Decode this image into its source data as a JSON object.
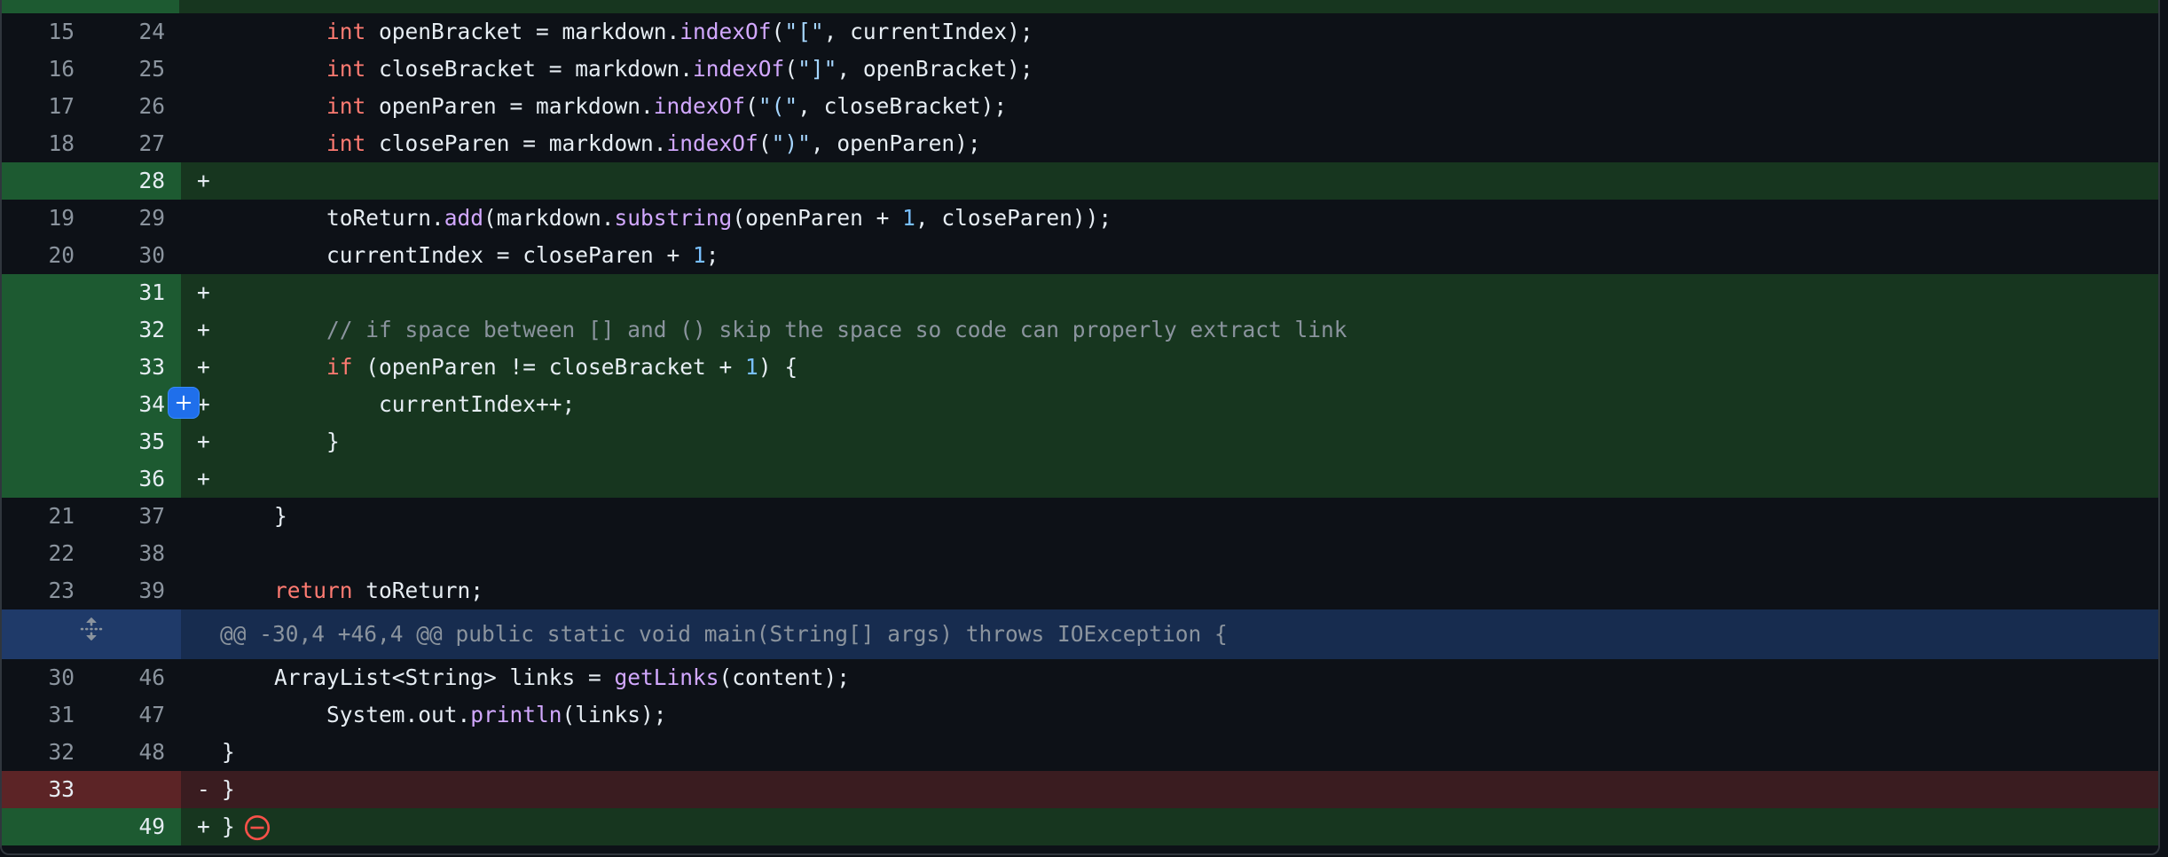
{
  "lines": [
    {
      "left": "15",
      "right": "24",
      "marker": " ",
      "code": "        int openBracket = markdown.indexOf(\"[\", currentIndex);"
    },
    {
      "left": "16",
      "right": "25",
      "marker": " ",
      "code": "        int closeBracket = markdown.indexOf(\"]\", openBracket);"
    },
    {
      "left": "17",
      "right": "26",
      "marker": " ",
      "code": "        int openParen = markdown.indexOf(\"(\", closeBracket);"
    },
    {
      "left": "18",
      "right": "27",
      "marker": " ",
      "code": "        int closeParen = markdown.indexOf(\")\", openParen);"
    },
    {
      "left": "",
      "right": "28",
      "marker": "+",
      "code": ""
    },
    {
      "left": "19",
      "right": "29",
      "marker": " ",
      "code": "        toReturn.add(markdown.substring(openParen + 1, closeParen));"
    },
    {
      "left": "20",
      "right": "30",
      "marker": " ",
      "code": "        currentIndex = closeParen + 1;"
    },
    {
      "left": "",
      "right": "31",
      "marker": "+",
      "code": ""
    },
    {
      "left": "",
      "right": "32",
      "marker": "+",
      "code": "        // if space between [] and () skip the space so code can properly extract link"
    },
    {
      "left": "",
      "right": "33",
      "marker": "+",
      "code": "        if (openParen != closeBracket + 1) {"
    },
    {
      "left": "",
      "right": "34",
      "marker": "+",
      "code": "            currentIndex++;"
    },
    {
      "left": "",
      "right": "35",
      "marker": "+",
      "code": "        }"
    },
    {
      "left": "",
      "right": "36",
      "marker": "+",
      "code": ""
    },
    {
      "left": "21",
      "right": "37",
      "marker": " ",
      "code": "    }"
    },
    {
      "left": "22",
      "right": "38",
      "marker": " ",
      "code": ""
    },
    {
      "left": "23",
      "right": "39",
      "marker": " ",
      "code": "    return toReturn;"
    },
    {
      "hunk": "@@ -30,4 +46,4 @@ public static void main(String[] args) throws IOException {"
    },
    {
      "left": "30",
      "right": "46",
      "marker": " ",
      "code": "    ArrayList<String> links = getLinks(content);"
    },
    {
      "left": "31",
      "right": "47",
      "marker": " ",
      "code": "        System.out.println(links);"
    },
    {
      "left": "32",
      "right": "48",
      "marker": " ",
      "code": "}"
    },
    {
      "left": "33",
      "right": "",
      "marker": "-",
      "code": "}"
    },
    {
      "left": "",
      "right": "49",
      "marker": "+",
      "code": "}"
    }
  ],
  "icons": {
    "expand": "unfold-icon",
    "add_comment": "plus-icon",
    "no_newline": "no-entry-icon"
  },
  "colors": {
    "background": "#0d1117",
    "addition_gutter": "#1d5a31",
    "addition_line": "#17361f",
    "deletion_gutter": "#5c2426",
    "deletion_line": "#3a1c20",
    "hunk_background": "#172c4f",
    "keyword": "#ff7b72",
    "function": "#d2a8ff",
    "string": "#a5d6ff",
    "number": "#79c0ff",
    "comment": "#8b949e",
    "button": "#1f6feb"
  }
}
